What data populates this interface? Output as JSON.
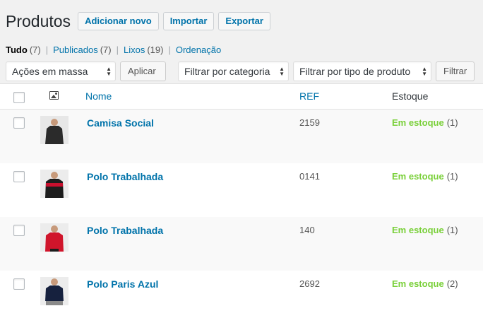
{
  "header": {
    "title": "Produtos",
    "buttons": [
      "Adicionar novo",
      "Importar",
      "Exportar"
    ]
  },
  "filters": [
    {
      "label": "Tudo",
      "count": "(7)",
      "current": true
    },
    {
      "label": "Publicados",
      "count": "(7)",
      "current": false
    },
    {
      "label": "Lixos",
      "count": "(19)",
      "current": false
    },
    {
      "label": "Ordenação",
      "count": "",
      "current": false
    }
  ],
  "tablenav": {
    "bulk_actions": "Ações em massa",
    "apply": "Aplicar",
    "filter_category": "Filtrar por categoria",
    "filter_type": "Filtrar por tipo de produto",
    "filter_button": "Filtrar"
  },
  "columns": {
    "name": "Nome",
    "ref": "REF",
    "stock": "Estoque"
  },
  "products": [
    {
      "name": "Camisa Social",
      "ref": "2159",
      "stock_status": "Em estoque",
      "stock_count": "(1)",
      "shirt_color": "#2b2b2b",
      "accent_color": "#2b2b2b"
    },
    {
      "name": "Polo Trabalhada",
      "ref": "0141",
      "stock_status": "Em estoque",
      "stock_count": "(1)",
      "shirt_color": "#1d1d1d",
      "accent_color": "#c8102e"
    },
    {
      "name": "Polo Trabalhada",
      "ref": "140",
      "stock_status": "Em estoque",
      "stock_count": "(1)",
      "shirt_color": "#d0152b",
      "accent_color": "#1d1d1d"
    },
    {
      "name": "Polo Paris Azul",
      "ref": "2692",
      "stock_status": "Em estoque",
      "stock_count": "(2)",
      "shirt_color": "#16213e",
      "accent_color": "#16213e"
    }
  ],
  "colors": {
    "link": "#0073aa",
    "in_stock": "#7ad03a"
  }
}
